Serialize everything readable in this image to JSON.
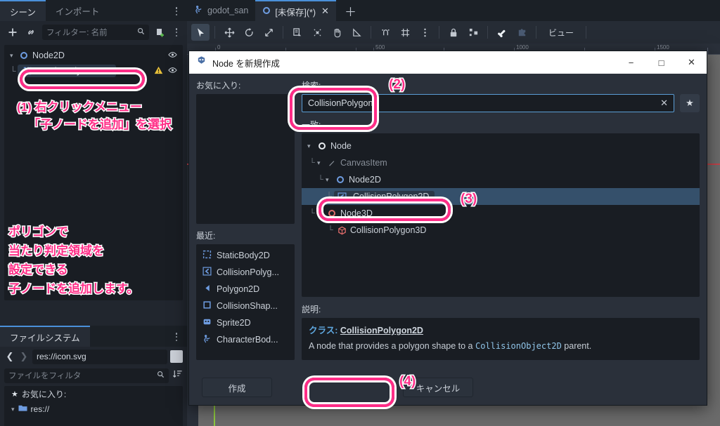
{
  "scene_dock": {
    "tabs": [
      {
        "label": "シーン",
        "active": true
      },
      {
        "label": "インポート",
        "active": false
      }
    ],
    "toolbar": {
      "add_icon": "plus-icon",
      "link_icon": "link-icon",
      "filter_placeholder": "フィルター: 名前",
      "search_icon": "search-icon",
      "script_icon": "attach-script-icon",
      "menu_icon": "kebab-menu-icon"
    },
    "tree": [
      {
        "label": "Node2D",
        "icon": "node2d-icon",
        "depth": 0,
        "expanded": true,
        "eye": "visibility-icon"
      },
      {
        "label": "StaticBody2D",
        "icon": "staticbody2d-icon",
        "depth": 1,
        "selected": true,
        "warning": "warning-icon",
        "eye": "visibility-icon"
      }
    ]
  },
  "annotations": {
    "a1_line1": "(1) 右クリックメニュー",
    "a1_line2": "「子ノードを追加」を選択",
    "a2_line1": "ポリゴンで",
    "a2_line2": "当たり判定領域を",
    "a2_line3": "設定できる",
    "a2_line4": "子ノードを追加します。",
    "step2": "(2)",
    "step3": "(3)",
    "step4": "(4)"
  },
  "filesystem_dock": {
    "tab_label": "ファイルシステム",
    "menu_icon": "kebab-menu-icon",
    "back_icon": "chevron-left-icon",
    "forward_icon": "chevron-right-icon",
    "path_value": "res://icon.svg",
    "filter_placeholder": "ファイルをフィルタ",
    "search_icon": "search-icon",
    "sort_icon": "sort-icon",
    "rows": [
      {
        "label": "お気に入り:",
        "icon": "star-icon"
      },
      {
        "label": "res://",
        "icon": "folder-icon",
        "expanded": true
      }
    ]
  },
  "main": {
    "tabs": [
      {
        "label": "godot_san",
        "icon": "characterbody-icon",
        "active": false
      },
      {
        "label": "[未保存](*)",
        "icon": "node2d-icon",
        "active": true,
        "close_icon": "close-icon"
      }
    ],
    "new_tab_icon": "plus-icon",
    "canvas_toolbar": {
      "tools": [
        {
          "name": "select-tool",
          "icon": "cursor-icon",
          "selected": true
        },
        {
          "name": "move-tool",
          "icon": "move-icon"
        },
        {
          "name": "rotate-tool",
          "icon": "rotate-icon"
        },
        {
          "name": "scale-tool",
          "icon": "scale-icon"
        },
        {
          "name": "list-select-tool",
          "icon": "list-select-icon"
        },
        {
          "name": "ruler-tool",
          "icon": "pivot-icon"
        },
        {
          "name": "pan-tool",
          "icon": "hand-icon"
        },
        {
          "name": "measure-tool",
          "icon": "ruler-icon"
        },
        {
          "name": "smart-snap",
          "icon": "snap-icon"
        },
        {
          "name": "grid-snap",
          "icon": "grid-icon"
        },
        {
          "name": "snap-options",
          "icon": "kebab-menu-icon"
        },
        {
          "name": "lock",
          "icon": "lock-icon"
        },
        {
          "name": "group",
          "icon": "group-icon"
        },
        {
          "name": "skeleton-bone",
          "icon": "bone-icon"
        },
        {
          "name": "skeleton-options",
          "icon": "puzzle-icon"
        }
      ],
      "view_menu": "ビュー"
    },
    "ruler_labels": [
      "0",
      "500",
      "1000",
      "1500"
    ]
  },
  "dialog": {
    "title": "Node を新規作成",
    "app_icon": "godot-icon",
    "window_buttons": {
      "minimize": "−",
      "maximize": "□",
      "close": "✕"
    },
    "favorites_label": "お気に入り:",
    "favorites_items": [],
    "recent_label": "最近:",
    "recent_items": [
      {
        "label": "StaticBody2D",
        "icon": "staticbody2d-icon"
      },
      {
        "label": "CollisionPolyg...",
        "icon": "collisionpolygon2d-icon"
      },
      {
        "label": "Polygon2D",
        "icon": "polygon2d-icon"
      },
      {
        "label": "CollisionShap...",
        "icon": "collisionshape2d-icon"
      },
      {
        "label": "Sprite2D",
        "icon": "sprite2d-icon"
      },
      {
        "label": "CharacterBod...",
        "icon": "characterbody2d-icon"
      }
    ],
    "search_label": "検索:",
    "search_value": "CollisionPolygon",
    "search_clear_icon": "close-icon",
    "favorite_toggle_icon": "star-icon",
    "matches_label": "一致:",
    "matches": [
      {
        "label": "Node",
        "icon": "node-icon",
        "depth": 0,
        "expanded": true
      },
      {
        "label": "CanvasItem",
        "icon": "canvasitem-icon",
        "depth": 1,
        "expanded": true,
        "dim": true
      },
      {
        "label": "Node2D",
        "icon": "node2d-icon",
        "depth": 2,
        "expanded": true
      },
      {
        "label": "CollisionPolygon2D",
        "icon": "collisionpolygon2d-icon",
        "depth": 3,
        "selected": true
      },
      {
        "label": "Node3D",
        "icon": "node3d-icon",
        "depth": 1,
        "expanded": true
      },
      {
        "label": "CollisionPolygon3D",
        "icon": "collisionpolygon3d-icon",
        "depth": 2
      }
    ],
    "description_label": "説明:",
    "description_class_prefix": "クラス: ",
    "description_class_name": "CollisionPolygon2D",
    "description_text_1": "A node that provides a polygon shape to a ",
    "description_code": "CollisionObject2D",
    "description_text_2": " parent.",
    "create_button": "作成",
    "cancel_button": "キャンセル"
  },
  "colors": {
    "accent_pink": "#ff2d87",
    "selection_blue": "#35506b",
    "panel_bg": "#21262e",
    "tree_bg": "#191d23",
    "dialog_bg": "#2a303a"
  }
}
